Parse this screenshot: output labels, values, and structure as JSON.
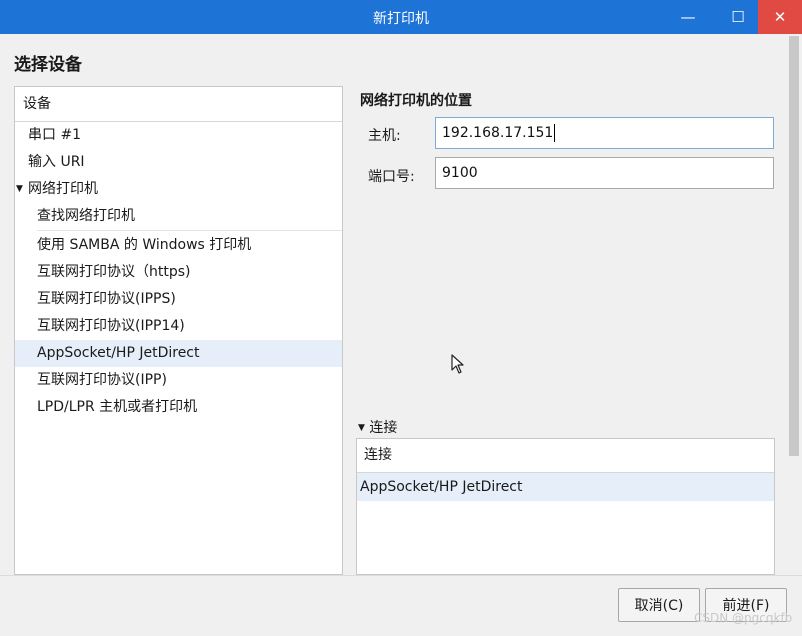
{
  "window": {
    "title": "新打印机",
    "controls": {
      "minimize": "—",
      "maximize": "☐",
      "close": "✕"
    }
  },
  "heading": "选择设备",
  "devices": {
    "header": "设备",
    "items": [
      {
        "label": "串口 #1",
        "indent": 0
      },
      {
        "label": "输入 URI",
        "indent": 0
      },
      {
        "label": "网络打印机",
        "indent": 0,
        "expanded": true
      },
      {
        "label": "查找网络打印机",
        "indent": 1
      },
      {
        "label": "使用 SAMBA 的 Windows 打印机",
        "indent": 1
      },
      {
        "label": "互联网打印协议（https)",
        "indent": 1
      },
      {
        "label": "互联网打印协议(IPPS)",
        "indent": 1
      },
      {
        "label": "互联网打印协议(IPP14)",
        "indent": 1
      },
      {
        "label": "AppSocket/HP JetDirect",
        "indent": 1,
        "selected": true
      },
      {
        "label": "互联网打印协议(IPP)",
        "indent": 1
      },
      {
        "label": "LPD/LPR 主机或者打印机",
        "indent": 1
      }
    ]
  },
  "location": {
    "title": "网络打印机的位置",
    "host_label": "主机:",
    "host_value": "192.168.17.151",
    "port_label": "端口号:",
    "port_value": "9100"
  },
  "connection": {
    "toggle_label": "连接",
    "header": "连接",
    "rows": [
      "AppSocket/HP JetDirect"
    ]
  },
  "buttons": {
    "cancel": "取消(C)",
    "next": "前进(F)"
  },
  "watermark": "CSDN @pgcqkfb",
  "colors": {
    "titlebar": "#1e73d6",
    "close": "#e14a43",
    "selection": "#e5eef9"
  }
}
